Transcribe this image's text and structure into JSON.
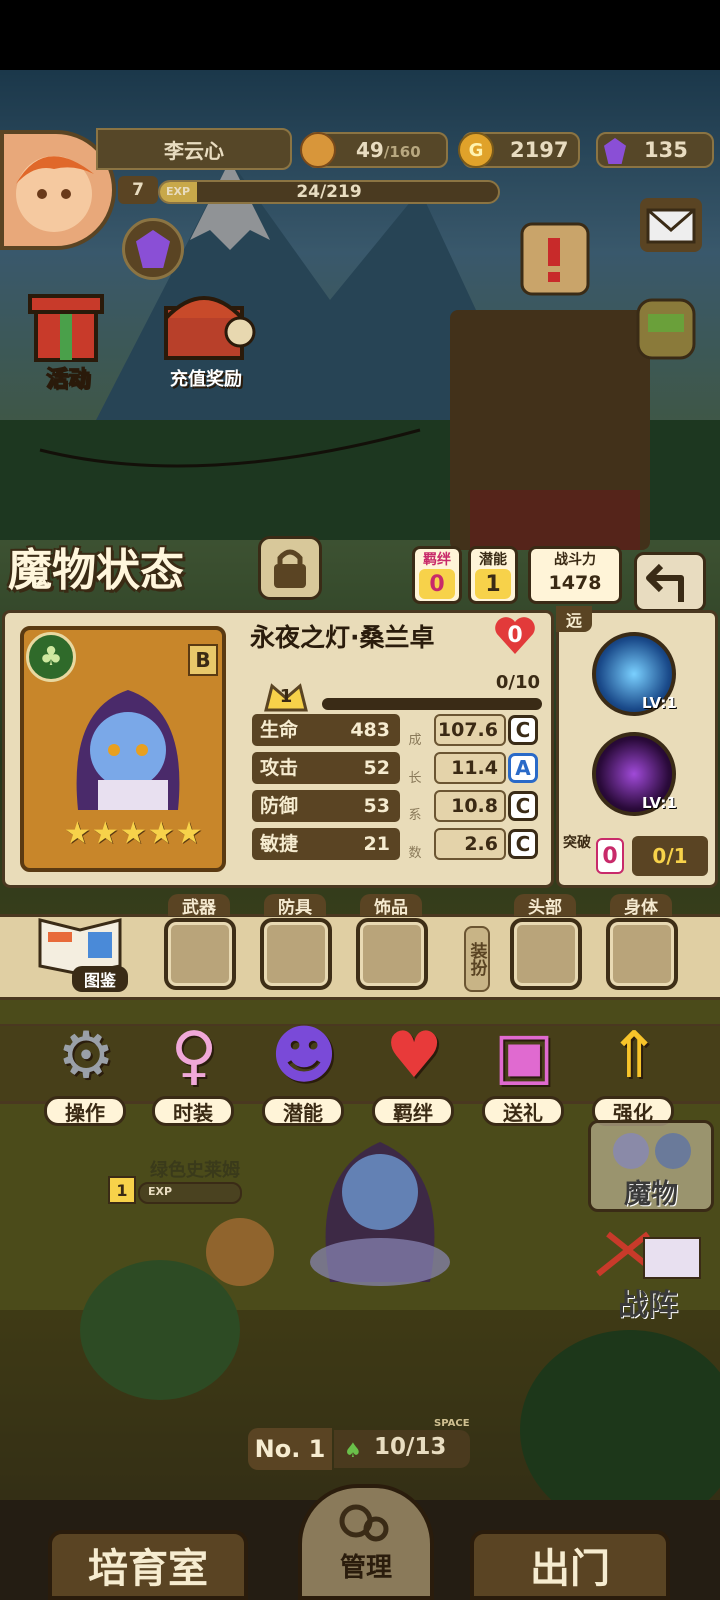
{
  "player": {
    "name": "李云心",
    "level": "7",
    "exp_label": "EXP",
    "exp_text": "24/219",
    "exp_progress": 0.11
  },
  "resources": {
    "stamina_current": "49",
    "stamina_max": "/160",
    "gold": "2197",
    "gems": "135"
  },
  "world_buttons": {
    "activity": "活动",
    "recharge_reward": "充值奖励"
  },
  "monster_status": {
    "title": "魔物状态",
    "bond_label": "羁绊",
    "bond_value": "0",
    "potential_label": "潜能",
    "potential_value": "1",
    "power_label": "战斗力",
    "power_value": "1478",
    "name": "永夜之灯·桑兰卓",
    "hearts": "0",
    "rank": "B",
    "stars": 5,
    "level": "1",
    "exp_text": "0/10",
    "exp_progress": 0,
    "growth_label": [
      "成",
      "长",
      "系",
      "数"
    ],
    "stats": [
      {
        "label": "生命",
        "value": "483",
        "growth": "107.6",
        "grade": "C"
      },
      {
        "label": "攻击",
        "value": "52",
        "growth": "11.4",
        "grade": "A"
      },
      {
        "label": "防御",
        "value": "53",
        "growth": "10.8",
        "grade": "C"
      },
      {
        "label": "敏捷",
        "value": "21",
        "growth": "2.6",
        "grade": "C"
      }
    ],
    "range_tag": "远",
    "skills": [
      {
        "level": "LV:1"
      },
      {
        "level": "LV:1"
      }
    ],
    "breakthrough_label": "突破",
    "breakthrough_value": "0",
    "breakthrough_progress": "0/1"
  },
  "equipment": {
    "handbook_label": "图鉴",
    "weapon": "武器",
    "armor": "防具",
    "accessory": "饰品",
    "dress_up": "装扮",
    "head": "头部",
    "body": "身体"
  },
  "actions": [
    {
      "label": "操作",
      "icon": "gear-icon"
    },
    {
      "label": "时装",
      "icon": "outfit-icon"
    },
    {
      "label": "潜能",
      "icon": "demon-icon"
    },
    {
      "label": "羁绊",
      "icon": "hearts-icon"
    },
    {
      "label": "送礼",
      "icon": "gift-icon"
    },
    {
      "label": "强化",
      "icon": "upgrade-arrows-icon"
    }
  ],
  "field": {
    "slime_name": "绿色史莱姆",
    "slime_level": "1",
    "slime_exp_label": "EXP",
    "monster_btn": "魔物",
    "formation_btn": "战阵",
    "room_no": "No. 1",
    "space_label": "SPACE",
    "space_value": "10/13"
  },
  "bottom_nav": {
    "nursery": "培育室",
    "manage": "管理",
    "exit": "出门"
  },
  "colors": {
    "accent_yellow": "#f7d24a",
    "panel_bg": "#e9dcb9",
    "frame_dark": "#4a3820",
    "gem_purple": "#8a4fd6",
    "heart_red": "#e23a3a"
  }
}
